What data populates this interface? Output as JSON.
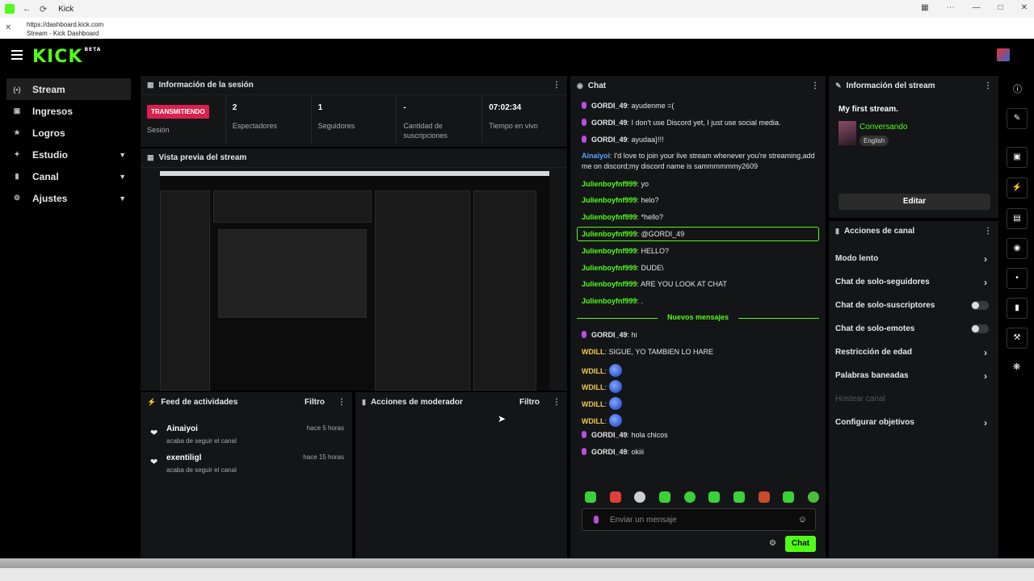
{
  "browser": {
    "tab_title": "Kick",
    "url": "https://dashboard.kick.com",
    "page_subtitle": "Stream - Kick Dashboard"
  },
  "brand": {
    "logo": "KICK",
    "tag": "BETA"
  },
  "sidebar": {
    "items": [
      {
        "label": "Stream",
        "icon": "stream-icon",
        "active": true
      },
      {
        "label": "Ingresos",
        "icon": "money-icon"
      },
      {
        "label": "Logros",
        "icon": "trophy-icon"
      },
      {
        "label": "Estudio",
        "icon": "studio-icon",
        "expandable": true
      },
      {
        "label": "Canal",
        "icon": "channel-icon",
        "expandable": true
      },
      {
        "label": "Ajustes",
        "icon": "gear-icon",
        "expandable": true
      }
    ]
  },
  "session": {
    "title": "Información de la sesión",
    "status": "TRANSMITIENDO",
    "status_label": "Sesión",
    "viewers": "2",
    "viewers_label": "Espectadores",
    "followers": "1",
    "followers_label": "Seguidores",
    "subs": "-",
    "subs_label": "Cantidad de suscripciones",
    "uptime": "07:02:34",
    "uptime_label": "Tiempo en vivo"
  },
  "preview": {
    "title": "Vista previa del stream"
  },
  "feed": {
    "title": "Feed de actividades",
    "filter": "Filtro",
    "items": [
      {
        "name": "Ainaiyoi",
        "desc": "acaba de seguir el canal",
        "time": "hace 5 horas"
      },
      {
        "name": "exentiligl",
        "desc": "acaba de seguir el canal",
        "time": "hace 15 horas"
      }
    ]
  },
  "mod_actions": {
    "title": "Acciones de moderador",
    "filter": "Filtro"
  },
  "chat": {
    "title": "Chat",
    "messages": [
      {
        "user": "GORDI_49",
        "text": "ayudenme =(",
        "mod": true
      },
      {
        "user": "GORDI_49",
        "text": "I don't use Discord yet, I just use social media.",
        "mod": true
      },
      {
        "user": "GORDI_49",
        "text": "ayudaa}!!!",
        "mod": true
      },
      {
        "user": "Ainaiyoi",
        "text": "I'd love to join your live stream whenever you're streaming,add me on discord;my discord name is sammmmmmy2609"
      },
      {
        "user": "Julienboyfnf999",
        "text": "yo"
      },
      {
        "user": "Julienboyfnf999",
        "text": "helo?"
      },
      {
        "user": "Julienboyfnf999",
        "text": "*hello?"
      },
      {
        "user": "Julienboyfnf999",
        "text": "@GORDI_49"
      },
      {
        "user": "Julienboyfnf999",
        "text": "HELLO?"
      },
      {
        "user": "Julienboyfnf999",
        "text": "DUDE\\"
      },
      {
        "user": "Julienboyfnf999",
        "text": "ARE YOU LOOK AT CHAT"
      },
      {
        "user": "Julienboyfnf999",
        "text": "."
      },
      {
        "user": "GORDI_49",
        "text": "hi",
        "mod": true
      },
      {
        "user": "WDILL",
        "text": "SIGUE, YO TAMBIEN LO HARE"
      },
      {
        "user": "WDILL",
        "text": ""
      },
      {
        "user": "WDILL",
        "text": ""
      },
      {
        "user": "WDILL",
        "text": ""
      },
      {
        "user": "WDILL",
        "text": ""
      },
      {
        "user": "GORDI_49",
        "text": "hola chicos",
        "mod": true
      },
      {
        "user": "GORDI_49",
        "text": "okiii",
        "mod": true
      }
    ],
    "new_messages_label": "Nuevos mensajes",
    "input_placeholder": "Enviar un mensaje",
    "send_label": "Chat"
  },
  "stream_info": {
    "title": "Información del stream",
    "stream_title": "My first stream.",
    "category": "Conversando",
    "language": "English",
    "edit_label": "Editar"
  },
  "channel_actions": {
    "title": "Acciones de canal",
    "items": [
      {
        "label": "Modo lento",
        "kind": "arrow"
      },
      {
        "label": "Chat de solo-seguidores",
        "kind": "arrow"
      },
      {
        "label": "Chat de solo-suscriptores",
        "kind": "toggle"
      },
      {
        "label": "Chat de solo-emotes",
        "kind": "toggle"
      },
      {
        "label": "Restricción de edad",
        "kind": "arrow"
      },
      {
        "label": "Palabras baneadas",
        "kind": "arrow"
      },
      {
        "label": "Hostear canal",
        "kind": "disabled"
      },
      {
        "label": "Configurar objetivos",
        "kind": "arrow"
      }
    ]
  },
  "colors": {
    "accent": "#53fc18",
    "live": "#d9204f",
    "panel": "#141517",
    "background": "#000000"
  }
}
